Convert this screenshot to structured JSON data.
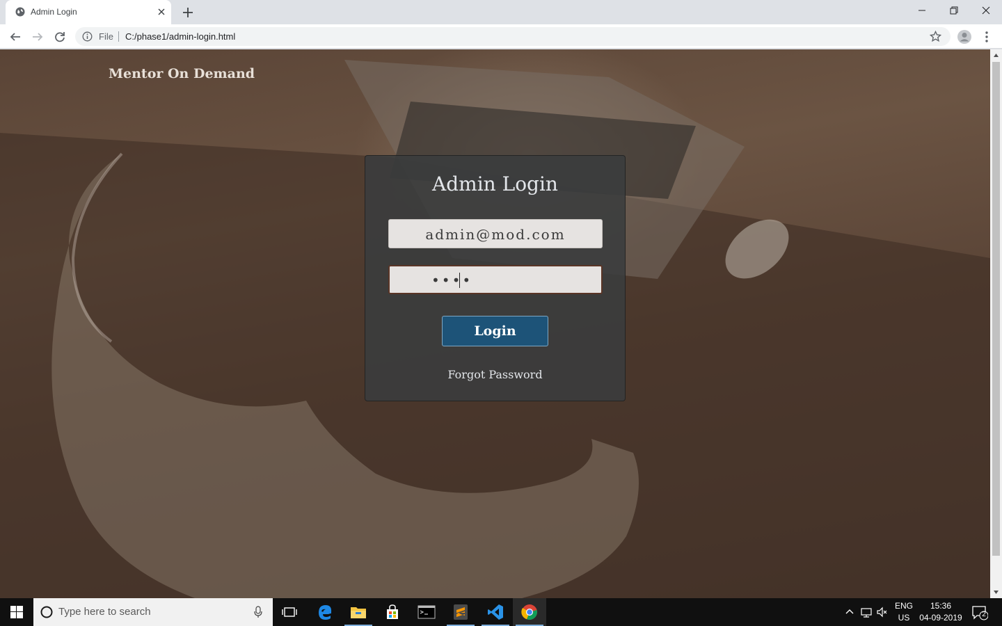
{
  "browser": {
    "tab_title": "Admin Login",
    "omnibox_scheme_label": "File",
    "url": "C:/phase1/admin-login.html"
  },
  "page": {
    "brand": "Mentor On Demand",
    "login": {
      "title": "Admin Login",
      "email_value": "admin@mod.com",
      "password_mask": "••••",
      "login_button": "Login",
      "forgot_link": "Forgot Password"
    }
  },
  "taskbar": {
    "search_placeholder": "Type here to search",
    "lang_line1": "ENG",
    "lang_line2": "US",
    "time": "15:36",
    "date": "04-09-2019",
    "notification_count": "2"
  },
  "colors": {
    "login_button": "#1d5378",
    "card_bg": "#3a3c3e",
    "taskbar": "#101010"
  }
}
